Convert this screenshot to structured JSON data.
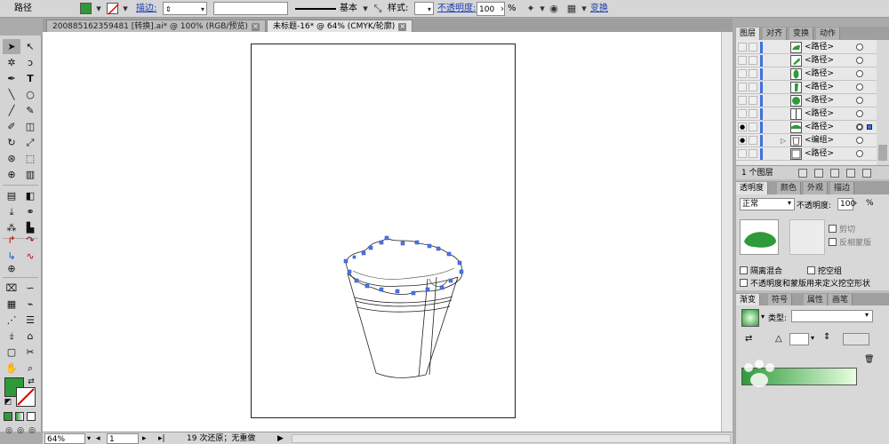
{
  "control_bar": {
    "object_type": "路径",
    "stroke_label": "描边:",
    "stroke_profile": "基本",
    "style_label": "样式:",
    "opacity_label": "不透明度:",
    "opacity_value": "100",
    "opacity_unit": "%",
    "transform_label": "变换",
    "fill_color": "#2f9a3a"
  },
  "tabs": [
    {
      "label": "200885162359481 [转换].ai* @ 100% (RGB/预览)",
      "active": false
    },
    {
      "label": "未标题-16* @ 64% (CMYK/轮廓)",
      "active": true
    }
  ],
  "status": {
    "zoom": "64%",
    "artboard": "1",
    "history": "19 次还原；无重做"
  },
  "panels": {
    "layers": {
      "tabs": [
        "图层",
        "对齐",
        "变换",
        "动作"
      ],
      "rows": [
        {
          "name": "<路径>",
          "visible": false,
          "selected": false
        },
        {
          "name": "<路径>",
          "visible": false,
          "selected": false
        },
        {
          "name": "<路径>",
          "visible": false,
          "selected": false
        },
        {
          "name": "<路径>",
          "visible": false,
          "selected": false
        },
        {
          "name": "<路径>",
          "visible": false,
          "selected": false
        },
        {
          "name": "<路径>",
          "visible": false,
          "selected": false
        },
        {
          "name": "<路径>",
          "visible": true,
          "selected": true
        },
        {
          "name": "<编组>",
          "visible": true,
          "selected": false
        },
        {
          "name": "<路径>",
          "visible": false,
          "selected": false
        }
      ],
      "footer": "1 个图层"
    },
    "transparency": {
      "tabs": [
        "透明度",
        "颜色",
        "外观",
        "描边"
      ],
      "mode": "正常",
      "opacity_label": "不透明度:",
      "opacity_value": "100",
      "opacity_unit": "%",
      "clip_label": "剪切",
      "invert_label": "反相蒙版",
      "isolate_label": "隔离混合",
      "knockout_label": "挖空组",
      "define_label": "不透明度和蒙版用来定义挖空形状"
    },
    "gradient": {
      "tabs": [
        "渐变",
        "符号",
        "属性",
        "画笔"
      ],
      "type_label": "类型:",
      "start_color": "#2f9a3a",
      "end_color": "#e7ffe0"
    }
  }
}
